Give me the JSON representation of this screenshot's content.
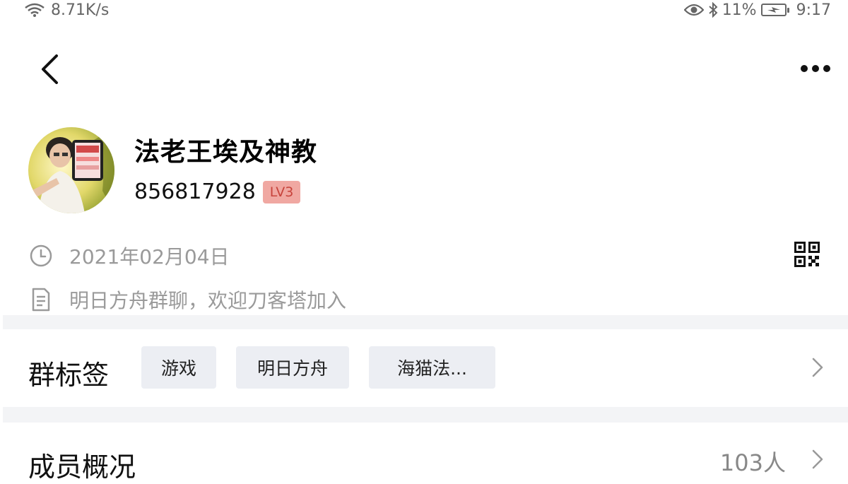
{
  "status_bar": {
    "network_speed": "8.71K/s",
    "battery_percent": "11%",
    "time": "9:17",
    "icons": [
      "wifi-icon",
      "eye-icon",
      "bluetooth-icon",
      "battery-charging-icon"
    ]
  },
  "header": {
    "back_icon": "chevron-left-icon",
    "more_icon": "more-dots-icon"
  },
  "profile": {
    "name": "法老王埃及神教",
    "id": "856817928",
    "level": "LV3"
  },
  "info": {
    "created_date": "2021年02月04日",
    "description": "明日方舟群聊，欢迎刀客塔加入"
  },
  "tags_section": {
    "title": "群标签",
    "tags": [
      "游戏",
      "明日方舟",
      "海猫法..."
    ]
  },
  "members_section": {
    "title": "成员概况",
    "count": "103人"
  },
  "colors": {
    "level_badge_bg": "#f0a8a2",
    "level_badge_text": "#c7443c",
    "tag_bg": "#eceef3",
    "divider": "#f3f4f6"
  }
}
